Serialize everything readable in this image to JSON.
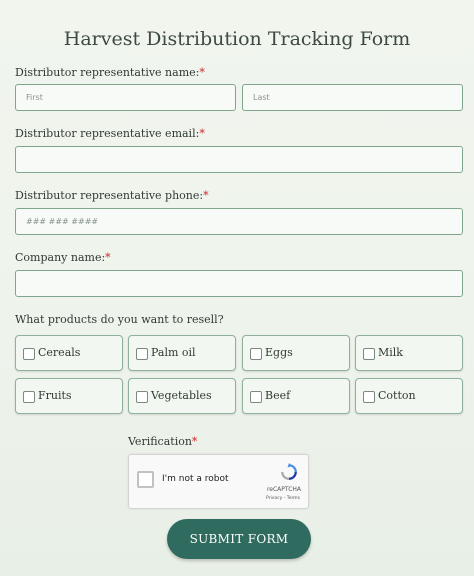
{
  "form": {
    "title": "Harvest Distribution Tracking Form",
    "required_mark": "*",
    "name": {
      "label": "Distributor representative name:",
      "first_placeholder": "First",
      "last_placeholder": "Last"
    },
    "email": {
      "label": "Distributor representative email:"
    },
    "phone": {
      "label": "Distributor representative phone:",
      "placeholder": "### ### ####"
    },
    "company": {
      "label": "Company name:"
    },
    "products": {
      "label": "What products do you want to resell?",
      "options": [
        "Cereals",
        "Palm oil",
        "Eggs",
        "Milk",
        "Fruits",
        "Vegetables",
        "Beef",
        "Cotton"
      ]
    },
    "verification": {
      "label": "Verification",
      "captcha_text": "I'm not a robot",
      "captcha_brand": "reCAPTCHA",
      "captcha_links": "Privacy - Terms"
    },
    "submit_label": "SUBMIT FORM"
  },
  "colors": {
    "accent": "#2f6b5e",
    "border": "#7fa68d",
    "required": "#c62828"
  }
}
